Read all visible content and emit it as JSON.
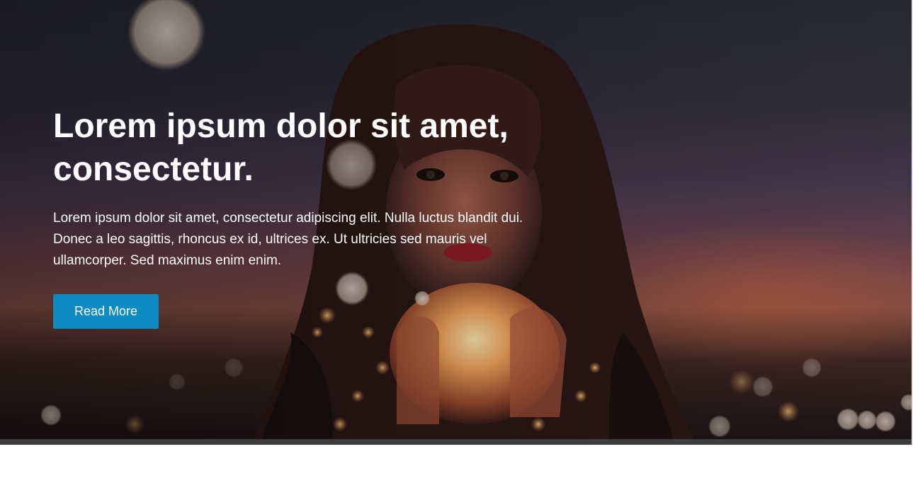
{
  "hero": {
    "title": "Lorem ipsum dolor sit amet, consectetur.",
    "text": "Lorem ipsum dolor sit amet, consectetur adipiscing elit. Nulla luctus blandit dui. Donec a leo sagittis, rhoncus ex id, ultrices ex. Ut ultricies sed mauris vel ullamcorper. Sed maximus enim enim.",
    "button_label": "Read More"
  },
  "colors": {
    "button": "#0e8bc3",
    "bottom_bar": "#3d3d3d"
  }
}
